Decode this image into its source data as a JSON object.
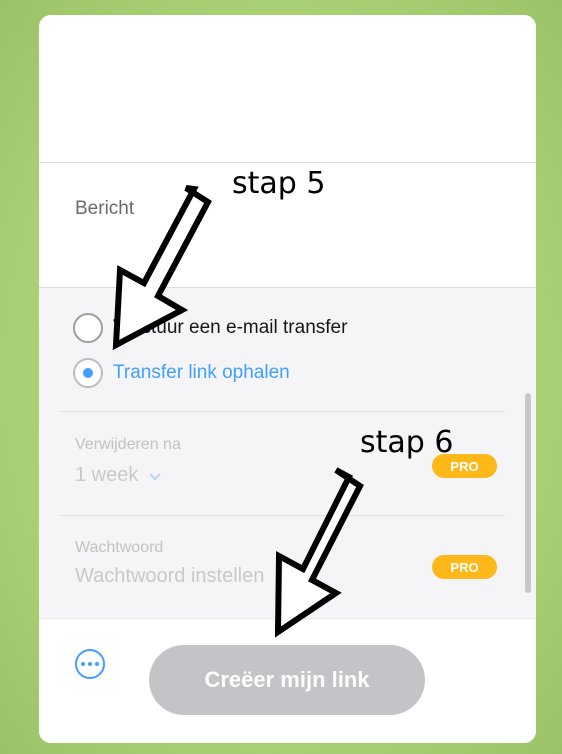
{
  "message": {
    "label": "Bericht"
  },
  "options": {
    "send_email_label": "Verstuur een e-mail transfer",
    "get_link_label": "Transfer link ophalen",
    "selected": "get_link"
  },
  "expiry": {
    "label": "Verwijderen na",
    "value": "1 week",
    "badge": "PRO"
  },
  "password": {
    "label": "Wachtwoord",
    "placeholder": "Wachtwoord instellen",
    "badge": "PRO"
  },
  "footer": {
    "create_label": "Creëer mijn link"
  },
  "annotations": {
    "step5": "stap 5",
    "step6": "stap 6"
  },
  "colors": {
    "accent": "#409fff",
    "pro_badge": "#ffb81a",
    "background": "#a9cf74",
    "disabled_button": "#c2c4c8"
  }
}
